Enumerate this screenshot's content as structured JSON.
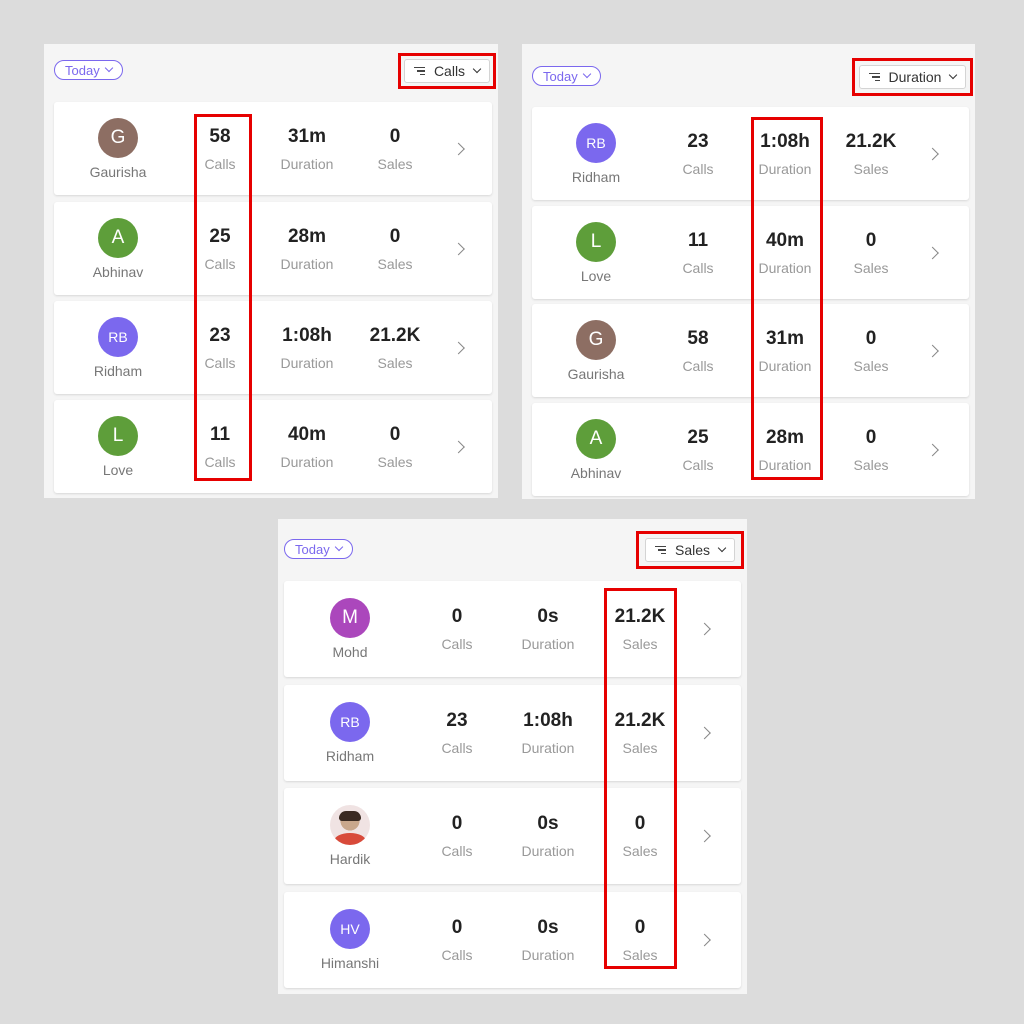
{
  "colors": {
    "accent": "#7b68ee",
    "highlight": "#e60000"
  },
  "metric_labels": {
    "calls": "Calls",
    "duration": "Duration",
    "sales": "Sales"
  },
  "panels": [
    {
      "period": "Today",
      "sort_label": "Calls",
      "rows": [
        {
          "initials": "G",
          "avatar_color": "#8d6e63",
          "name": "Gaurisha",
          "calls": "58",
          "duration": "31m",
          "sales": "0"
        },
        {
          "initials": "A",
          "avatar_color": "#5e9e3a",
          "name": "Abhinav",
          "calls": "25",
          "duration": "28m",
          "sales": "0"
        },
        {
          "initials": "RB",
          "avatar_color": "#7b68ee",
          "name": "Ridham",
          "calls": "23",
          "duration": "1:08h",
          "sales": "21.2K"
        },
        {
          "initials": "L",
          "avatar_color": "#5e9e3a",
          "name": "Love",
          "calls": "11",
          "duration": "40m",
          "sales": "0"
        }
      ]
    },
    {
      "period": "Today",
      "sort_label": "Duration",
      "rows": [
        {
          "initials": "RB",
          "avatar_color": "#7b68ee",
          "name": "Ridham",
          "calls": "23",
          "duration": "1:08h",
          "sales": "21.2K"
        },
        {
          "initials": "L",
          "avatar_color": "#5e9e3a",
          "name": "Love",
          "calls": "11",
          "duration": "40m",
          "sales": "0"
        },
        {
          "initials": "G",
          "avatar_color": "#8d6e63",
          "name": "Gaurisha",
          "calls": "58",
          "duration": "31m",
          "sales": "0"
        },
        {
          "initials": "A",
          "avatar_color": "#5e9e3a",
          "name": "Abhinav",
          "calls": "25",
          "duration": "28m",
          "sales": "0"
        }
      ]
    },
    {
      "period": "Today",
      "sort_label": "Sales",
      "rows": [
        {
          "initials": "M",
          "avatar_color": "#ab47bc",
          "name": "Mohd",
          "calls": "0",
          "duration": "0s",
          "sales": "21.2K"
        },
        {
          "initials": "RB",
          "avatar_color": "#7b68ee",
          "name": "Ridham",
          "calls": "23",
          "duration": "1:08h",
          "sales": "21.2K"
        },
        {
          "initials": "",
          "avatar_color": "",
          "name": "Hardik",
          "calls": "0",
          "duration": "0s",
          "sales": "0",
          "avatar_type": "photo"
        },
        {
          "initials": "HV",
          "avatar_color": "#7b68ee",
          "name": "Himanshi",
          "calls": "0",
          "duration": "0s",
          "sales": "0"
        }
      ]
    }
  ]
}
